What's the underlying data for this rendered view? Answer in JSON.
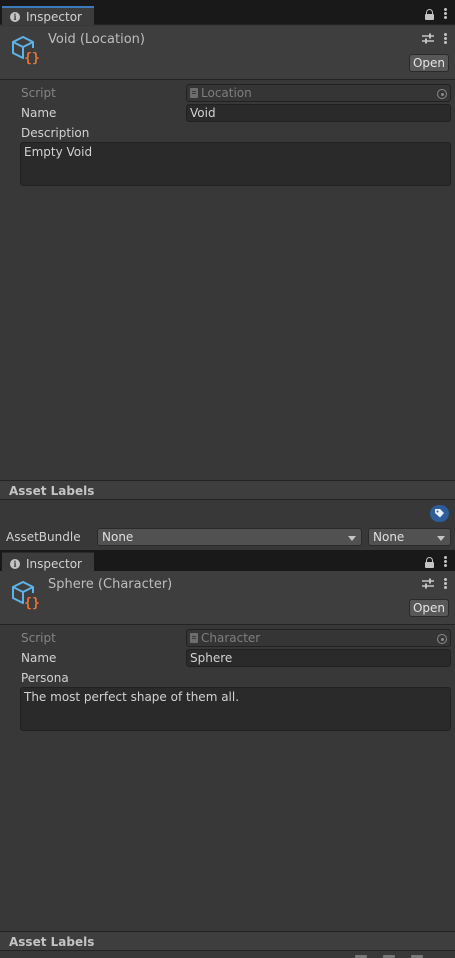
{
  "panels": [
    {
      "tab_label": "Inspector",
      "title": "Void (Location)",
      "open_label": "Open",
      "script_label": "Script",
      "script_value": "Location",
      "name_label": "Name",
      "name_value": "Void",
      "text_label": "Description",
      "text_value": "Empty Void",
      "asset_labels": "Asset Labels"
    },
    {
      "tab_label": "Inspector",
      "title": "Sphere (Character)",
      "open_label": "Open",
      "script_label": "Script",
      "script_value": "Character",
      "name_label": "Name",
      "name_value": "Sphere",
      "text_label": "Persona",
      "text_value": "The most perfect shape of them all.",
      "asset_labels": "Asset Labels"
    }
  ],
  "asset_bundle": {
    "label": "AssetBundle",
    "bundle_value": "None",
    "variant_value": "None"
  },
  "colors": {
    "accent": "#3a79bb",
    "icon_blue": "#5fb2e6",
    "icon_orange": "#e8743b",
    "panel_bg": "#383838"
  }
}
